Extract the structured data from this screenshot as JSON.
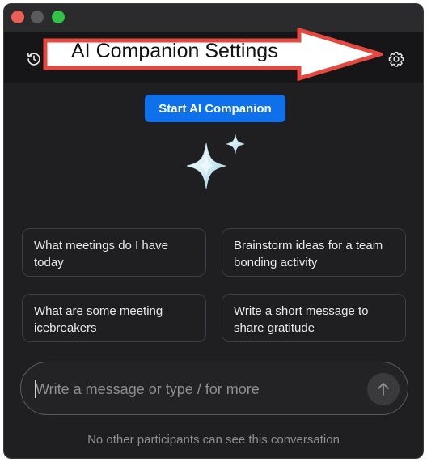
{
  "window": {
    "controls": [
      "close",
      "minimize",
      "zoom"
    ]
  },
  "header": {
    "history_icon": "history-clock-icon",
    "settings_icon": "gear-icon"
  },
  "annotation": {
    "label": "AI Companion Settings",
    "color": "#e5483e"
  },
  "start_button": {
    "label": "Start AI Companion",
    "color": "#0e71eb"
  },
  "sparkle_icon": "ai-sparkle-icon",
  "prompts": [
    {
      "label": "What meetings do I have today"
    },
    {
      "label": "Brainstorm ideas for a team bonding activity"
    },
    {
      "label": "What are some meeting icebreakers"
    },
    {
      "label": "Write a short message to share gratitude"
    }
  ],
  "composer": {
    "placeholder": "Write a message or type / for more",
    "value": "",
    "send_icon": "arrow-up-icon"
  },
  "footer": {
    "privacy_text": "No other participants can see this conversation"
  }
}
